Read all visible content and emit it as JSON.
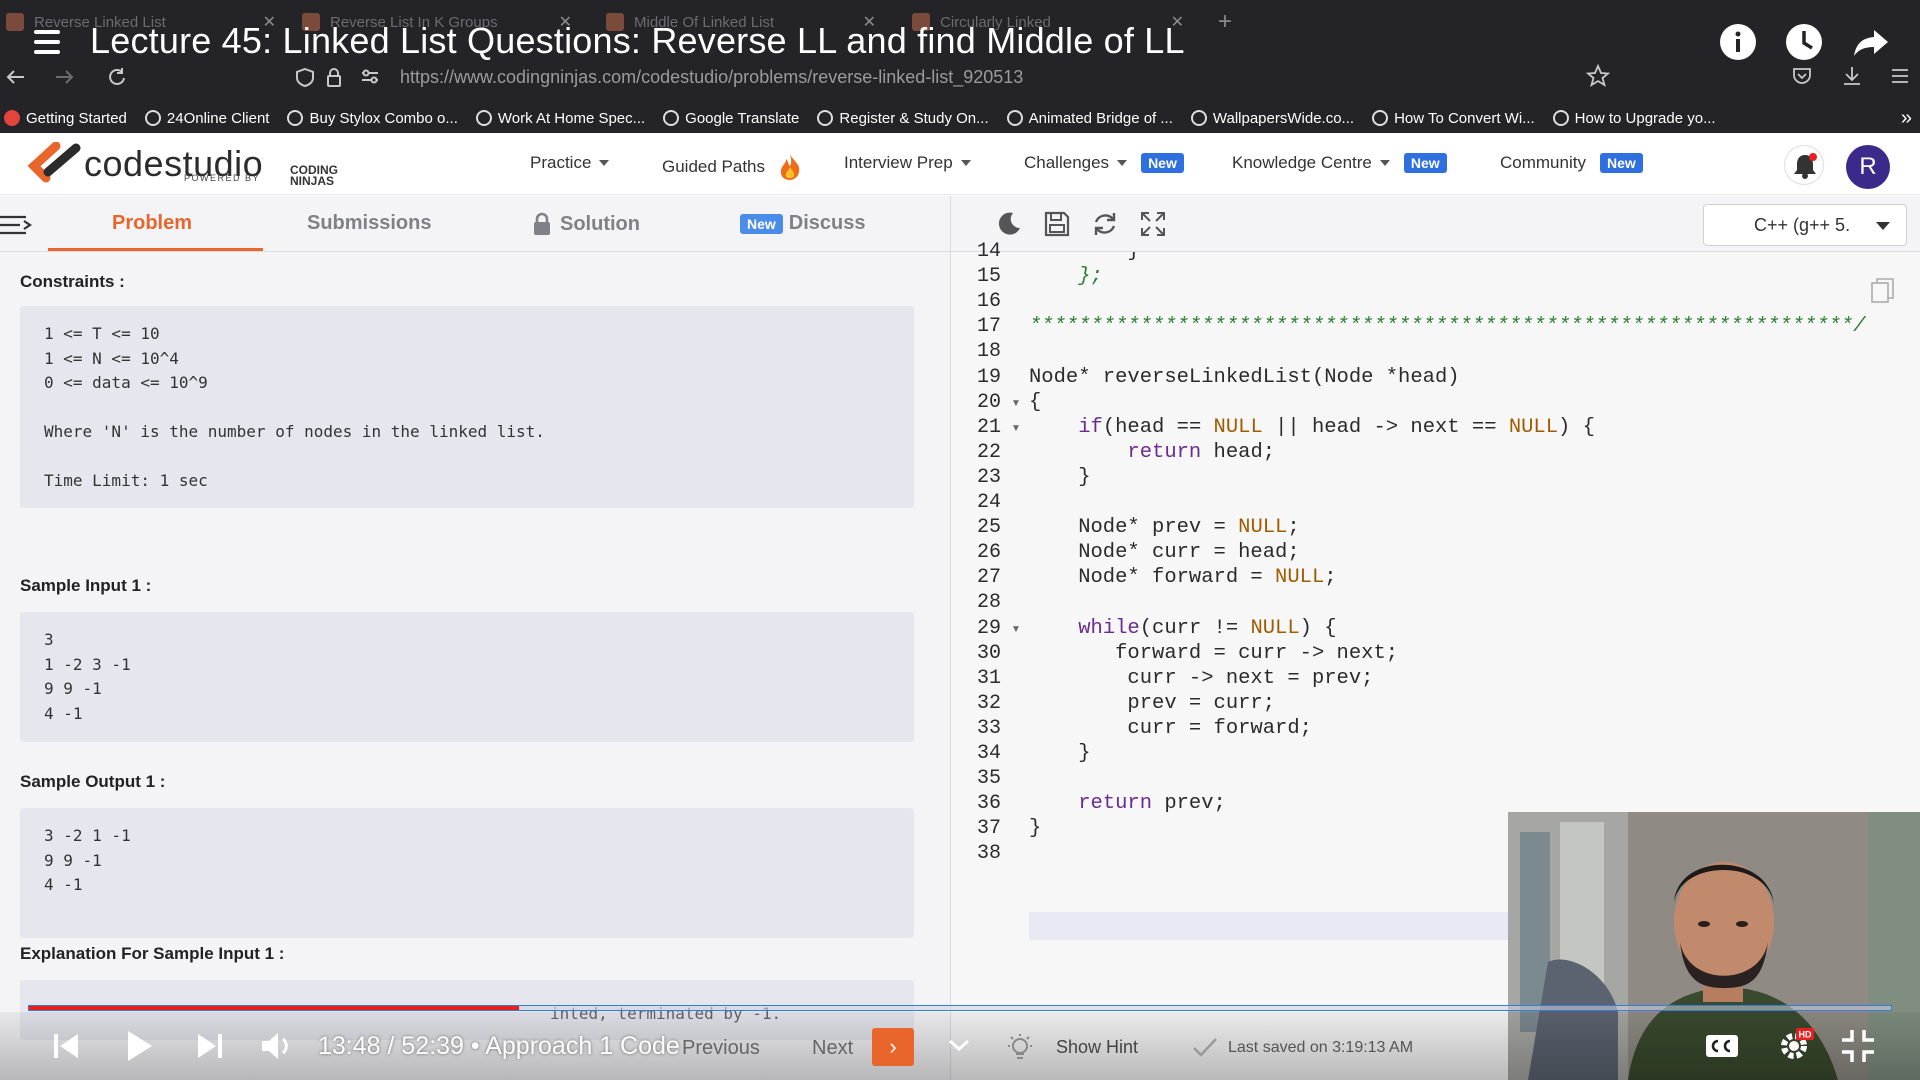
{
  "browser": {
    "tabs": [
      {
        "title": "Reverse Linked List"
      },
      {
        "title": "Reverse List In K Groups"
      },
      {
        "title": "Middle Of Linked List"
      },
      {
        "title": "Circularly Linked"
      }
    ],
    "url": "https://www.codingninjas.com/codestudio/problems/reverse-linked-list_920513",
    "bookmarks": [
      "Getting Started",
      "24Online Client",
      "Buy Stylox Combo o...",
      "Work At Home Spec...",
      "Google Translate",
      "Register & Study On...",
      "Animated Bridge of ...",
      "WallpapersWide.co...",
      "How To Convert Wi...",
      "How to Upgrade yo..."
    ]
  },
  "video": {
    "title": "Lecture 45: Linked List Questions: Reverse LL and find Middle of LL",
    "time": "13:48 / 52:39 • Approach 1 Code",
    "progress_fraction": 0.263
  },
  "site": {
    "logo": "codestudio",
    "logo_powered": "POWERED BY",
    "logo_brand": [
      "CODING",
      "NINJAS"
    ],
    "nav": [
      {
        "label": "Practice",
        "dropdown": true,
        "badge": ""
      },
      {
        "label": "Guided Paths",
        "dropdown": false,
        "badge": ""
      },
      {
        "label": "Interview Prep",
        "dropdown": true,
        "badge": ""
      },
      {
        "label": "Challenges",
        "dropdown": true,
        "badge": "New"
      },
      {
        "label": "Knowledge Centre",
        "dropdown": true,
        "badge": "New"
      },
      {
        "label": "Community",
        "dropdown": false,
        "badge": "New"
      }
    ],
    "avatar_letter": "R"
  },
  "problem_tabs": {
    "problem": "Problem",
    "submissions": "Submissions",
    "solution": "Solution",
    "discuss_badge": "New",
    "discuss": "Discuss"
  },
  "problem": {
    "constraints_title": "Constraints :",
    "constraints": "1 <= T <= 10\n1 <= N <= 10^4\n0 <= data <= 10^9\n\nWhere 'N' is the number of nodes in the linked list.\n\nTime Limit: 1 sec",
    "sample_input_title": "Sample Input 1 :",
    "sample_input": "3\n1 -2 3 -1\n9 9 -1\n4 -1",
    "sample_output_title": "Sample Output 1 :",
    "sample_output": "3 -2 1 -1\n9 9 -1\n4 -1",
    "explanation_title": "Explanation For Sample Input 1 :",
    "explanation_partial": "inted, terminated by -1."
  },
  "editor": {
    "language": "C++ (g++ 5.",
    "lines": [
      {
        "n": "14",
        "t": "        }"
      },
      {
        "n": "15",
        "t": "    };"
      },
      {
        "n": "16",
        "t": ""
      },
      {
        "n": "17",
        "t": "*******************************************************************/"
      },
      {
        "n": "18",
        "t": ""
      },
      {
        "n": "19",
        "t": "Node* reverseLinkedList(Node *head)"
      },
      {
        "n": "20",
        "t": "{"
      },
      {
        "n": "21",
        "t": "    if(head == NULL || head -> next == NULL) {"
      },
      {
        "n": "22",
        "t": "        return head;"
      },
      {
        "n": "23",
        "t": "    }"
      },
      {
        "n": "24",
        "t": ""
      },
      {
        "n": "25",
        "t": "    Node* prev = NULL;"
      },
      {
        "n": "26",
        "t": "    Node* curr = head;"
      },
      {
        "n": "27",
        "t": "    Node* forward = NULL;"
      },
      {
        "n": "28",
        "t": ""
      },
      {
        "n": "29",
        "t": "    while(curr != NULL) {"
      },
      {
        "n": "30",
        "t": "       forward = curr -> next;"
      },
      {
        "n": "31",
        "t": "        curr -> next = prev;"
      },
      {
        "n": "32",
        "t": "        prev = curr;"
      },
      {
        "n": "33",
        "t": "        curr = forward;"
      },
      {
        "n": "34",
        "t": "    }"
      },
      {
        "n": "35",
        "t": ""
      },
      {
        "n": "36",
        "t": "    return prev;"
      },
      {
        "n": "37",
        "t": "}"
      },
      {
        "n": "38",
        "t": ""
      }
    ],
    "fold_lines": [
      "20",
      "21",
      "29"
    ]
  },
  "footer": {
    "previous": "Previous",
    "next": "Next",
    "show_hint": "Show Hint",
    "last_saved": "Last saved on 3:19:13 AM"
  },
  "colors": {
    "accent": "#e8662c",
    "badge_blue": "#2f6fe0",
    "keyword": "#6a2c8f",
    "null_constant": "#a05c00",
    "comment_green": "#2f7d32",
    "progress_red": "#e62020"
  }
}
